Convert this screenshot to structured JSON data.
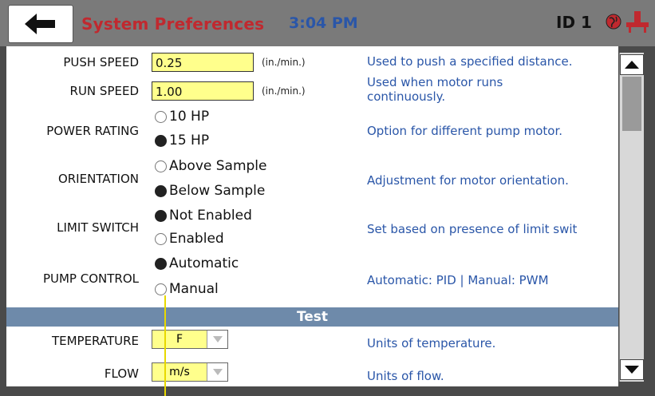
{
  "header": {
    "title": "System Preferences",
    "time": "3:04 PM",
    "device_id": "ID 1"
  },
  "settings": {
    "push_speed": {
      "label": "PUSH SPEED",
      "value": "0.25",
      "unit": "(in./min.)",
      "desc": "Used to push a specified distance."
    },
    "run_speed": {
      "label": "RUN SPEED",
      "value": "1.00",
      "unit": "(in./min.)",
      "desc_line1": "Used when motor runs",
      "desc_line2": "continuously."
    },
    "power_rating": {
      "label": "POWER RATING",
      "options": [
        "10 HP",
        "15 HP"
      ],
      "selected": "15 HP",
      "desc": "Option for different pump motor."
    },
    "orientation": {
      "label": "ORIENTATION",
      "options": [
        "Above Sample",
        "Below Sample"
      ],
      "selected": "Below Sample",
      "desc": "Adjustment for motor orientation."
    },
    "limit_switch": {
      "label": "LIMIT SWITCH",
      "options": [
        "Not Enabled",
        "Enabled"
      ],
      "selected": "Not Enabled",
      "desc": "Set based on presence of limit swit"
    },
    "pump_control": {
      "label": "PUMP CONTROL",
      "options": [
        "Automatic",
        "Manual"
      ],
      "selected": "Automatic",
      "desc": "Automatic: PID | Manual: PWM"
    }
  },
  "test_section": {
    "title": "Test",
    "temperature": {
      "label": "TEMPERATURE",
      "value": "F",
      "desc": "Units of temperature."
    },
    "flow": {
      "label": "FLOW",
      "value": "m/s",
      "desc": "Units of flow."
    }
  },
  "colors": {
    "title": "#c0292f",
    "time": "#2a56a8",
    "description": "#2a56a8",
    "input_bg": "#ffff8c",
    "section_bar": "#6e8aaa"
  },
  "icons": [
    "back-arrow-icon",
    "globe-icon",
    "plug-icon",
    "scroll-up-icon",
    "scroll-down-icon",
    "dropdown-arrow-icon"
  ]
}
